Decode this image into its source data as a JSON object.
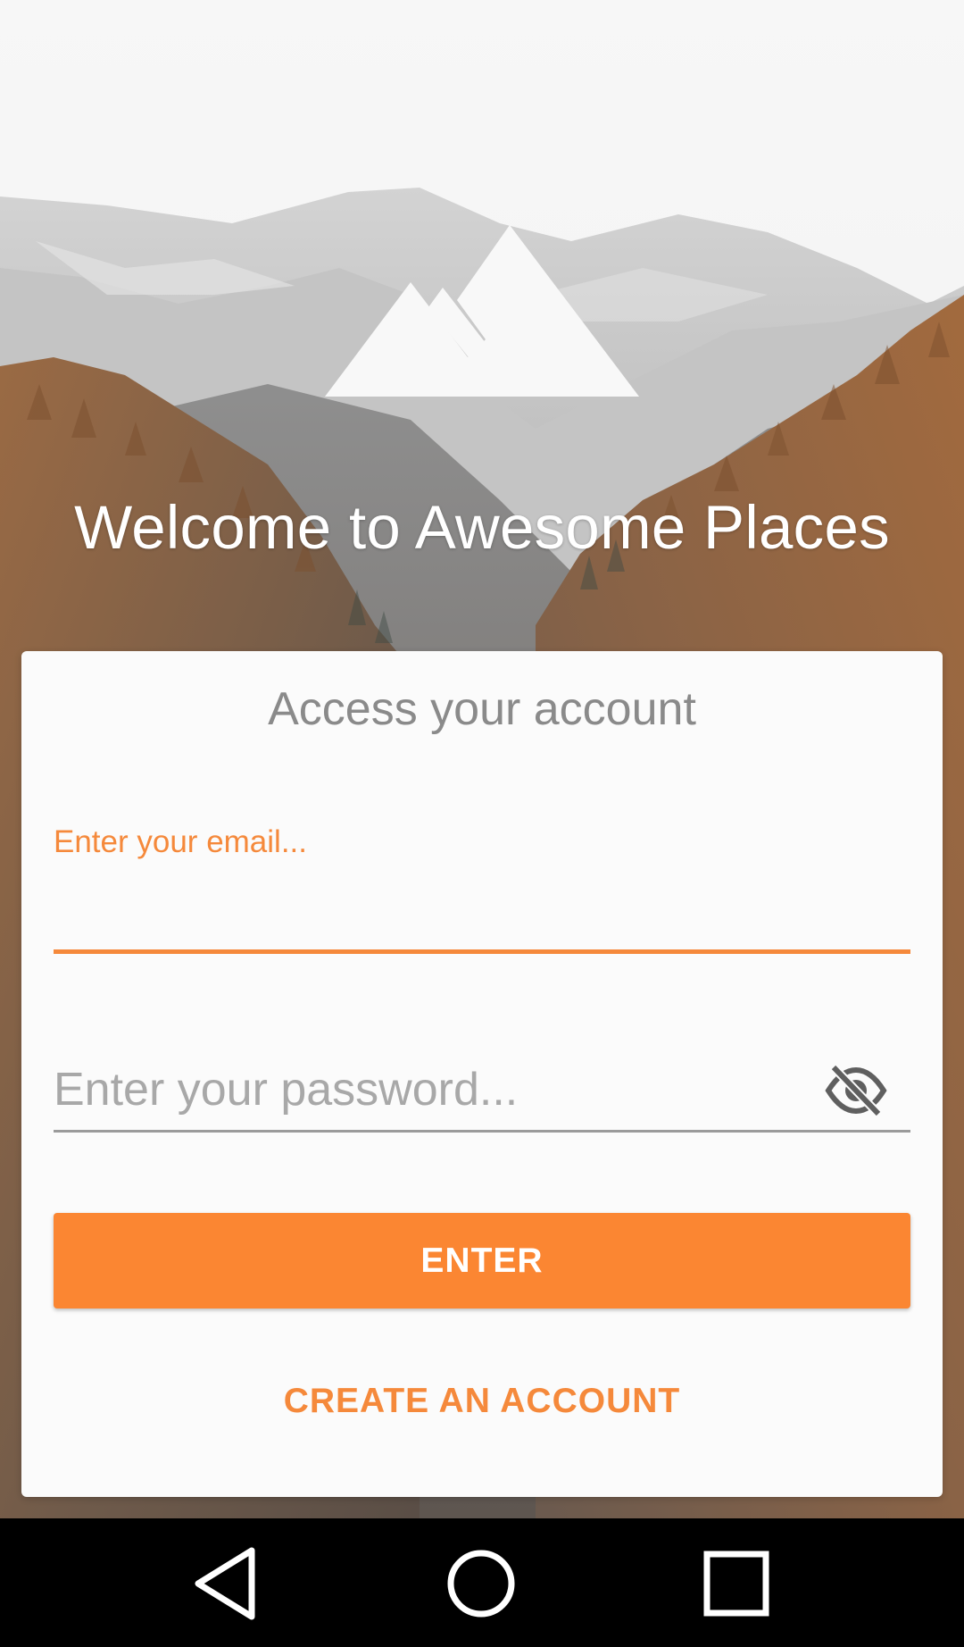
{
  "header": {
    "welcome_title": "Welcome to Awesome Places",
    "logo_icon": "mountain-icon"
  },
  "login_card": {
    "title": "Access your account",
    "email": {
      "label": "Enter your email...",
      "value": ""
    },
    "password": {
      "placeholder": "Enter your password...",
      "value": "",
      "visibility_icon": "eye-off-icon"
    },
    "enter_label": "ENTER",
    "create_account_label": "CREATE AN ACCOUNT"
  },
  "nav_bar": {
    "back_icon": "back-triangle-icon",
    "home_icon": "home-circle-icon",
    "recents_icon": "recents-square-icon"
  },
  "colors": {
    "accent": "#fb8632",
    "accent_text": "#f5893b",
    "card_background": "#fbfbfb",
    "muted_text": "#8a8a8a",
    "nav_bar": "#000000"
  }
}
